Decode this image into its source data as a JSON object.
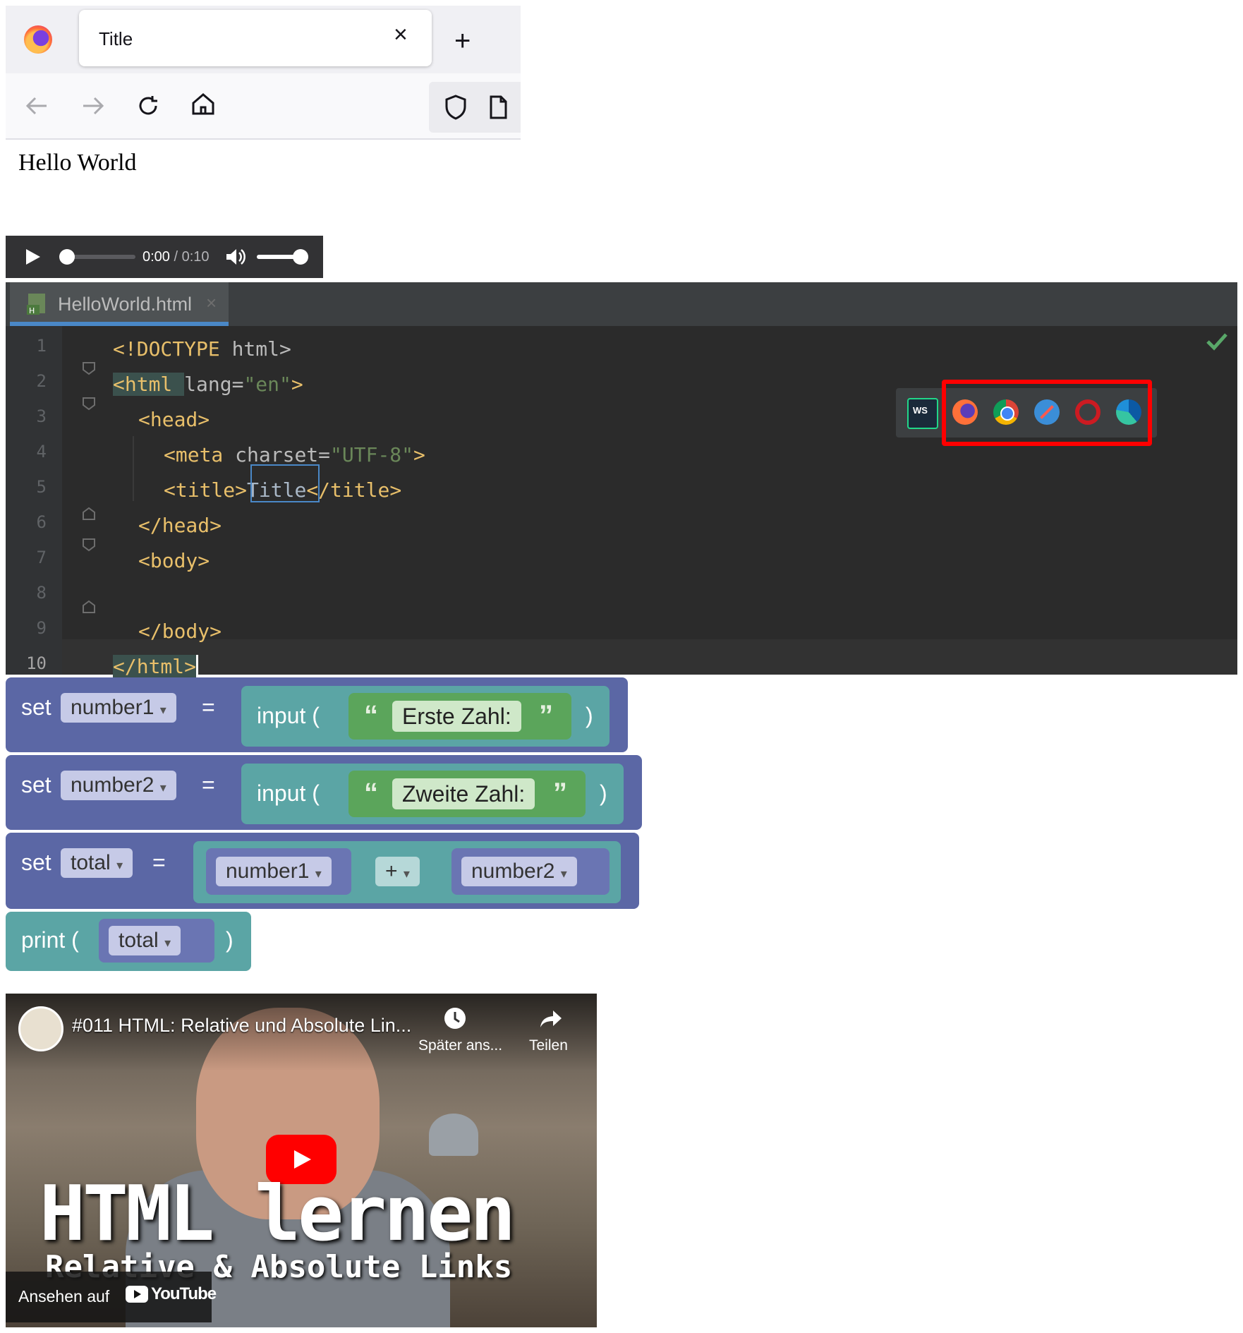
{
  "browser": {
    "tab_title": "Title",
    "tab_close": "×",
    "new_tab": "+",
    "page_text": "Hello World"
  },
  "audio": {
    "current_time": "0:00",
    "duration": "/ 0:10",
    "progress": 0,
    "volume": 1.0
  },
  "ide": {
    "tab_label": "HelloWorld.html",
    "tab_close": "×",
    "line_numbers": [
      "1",
      "2",
      "3",
      "4",
      "5",
      "6",
      "7",
      "8",
      "9",
      "10"
    ],
    "code": {
      "l1_tag": "<!DOCTYPE ",
      "l1_rest": "html>",
      "l2_tag": "<html ",
      "l2_attr": "lang=",
      "l2_val": "\"en\"",
      "l2_end": ">",
      "l3": "<head>",
      "l4_tag": "<meta ",
      "l4_attr": "charset=",
      "l4_val": "\"UTF-8\"",
      "l4_end": ">",
      "l5_open": "<title>",
      "l5_text": "Title",
      "l5_close": "</title>",
      "l6": "</head>",
      "l7": "<body>",
      "l9": "</body>",
      "l10": "</html>"
    },
    "popup_icons": [
      "webstorm-icon",
      "firefox-icon",
      "chrome-icon",
      "safari-icon",
      "opera-icon",
      "edge-icon"
    ],
    "highlight_color": "#ff0000"
  },
  "blockly": {
    "b1": {
      "set": "set",
      "var": "number1",
      "eq": "=",
      "fn": "input (",
      "open_q": "“",
      "str": "Erste Zahl:",
      "close_q": "”",
      "close": ")"
    },
    "b2": {
      "set": "set",
      "var": "number2",
      "eq": "=",
      "fn": "input (",
      "open_q": "“",
      "str": "Zweite Zahl:",
      "close_q": "”",
      "close": ")"
    },
    "b3": {
      "set": "set",
      "var": "total",
      "eq": "=",
      "left": "number1",
      "op": "+",
      "right": "number2"
    },
    "b4": {
      "fn": "print (",
      "var": "total",
      "close": ")"
    },
    "dropdown_arrow": "▾"
  },
  "youtube": {
    "title": "#011 HTML: Relative und Absolute Lin...",
    "later": "Später ans...",
    "share": "Teilen",
    "big_text": "HTML lernen",
    "sub_text": "Relative & Absolute Links",
    "watch_on": "Ansehen auf",
    "logo_text": "YouTube"
  }
}
